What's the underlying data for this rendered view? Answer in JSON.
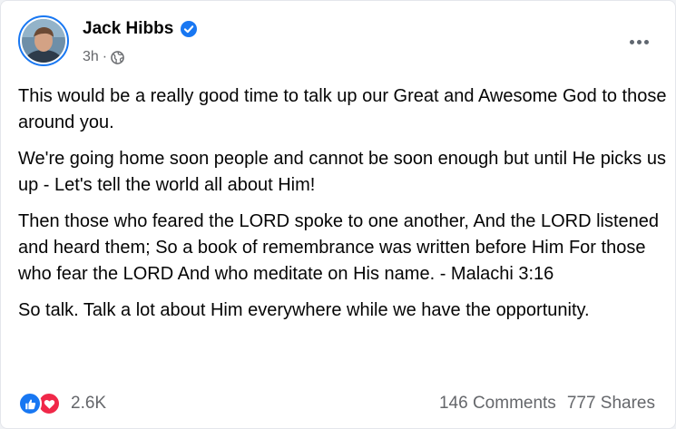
{
  "post": {
    "author": "Jack Hibbs",
    "verified": true,
    "time": "3h",
    "separator": "·",
    "audience_icon": "globe-icon",
    "paragraphs": [
      "This would be a really good time to talk up our Great and Awesome God to those around you.",
      "We're going home soon people and cannot be soon enough but until He picks us up - Let's tell the world all about Him!",
      "Then those who feared the LORD spoke to one another, And the LORD listened and heard them; So a book of remembrance was written before Him For those who fear the LORD And who meditate on His name. - Malachi 3:16",
      "So talk. Talk a lot about Him everywhere while we have the opportunity."
    ]
  },
  "footer": {
    "reaction_icons": [
      "like-icon",
      "love-icon"
    ],
    "reaction_count": "2.6K",
    "comments": "146 Comments",
    "shares": "777 Shares"
  },
  "colors": {
    "accent": "#1877f2",
    "love": "#f02849",
    "text": "#050505",
    "secondary_text": "#65676b"
  }
}
